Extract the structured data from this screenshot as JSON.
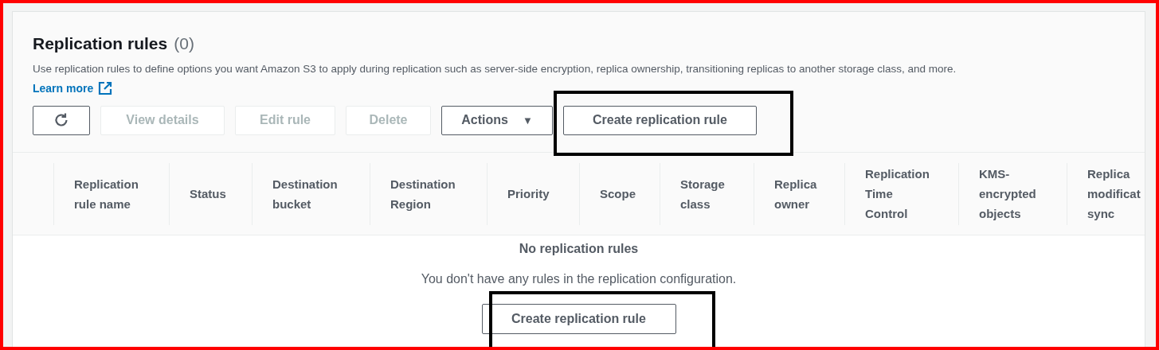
{
  "panel": {
    "title": "Replication rules",
    "count": "(0)",
    "description": "Use replication rules to define options you want Amazon S3 to apply during replication such as server-side encryption, replica ownership, transitioning replicas to another storage class, and more.",
    "learn_more": "Learn more"
  },
  "toolbar": [
    {
      "kind": "refresh",
      "disabled": false
    },
    {
      "kind": "text",
      "label": "View details",
      "disabled": true
    },
    {
      "kind": "text",
      "label": "Edit rule",
      "disabled": true
    },
    {
      "kind": "text",
      "label": "Delete",
      "disabled": true
    },
    {
      "kind": "dropdown",
      "label": "Actions",
      "caret": "▼",
      "disabled": false
    },
    {
      "kind": "text",
      "label": "Create replication rule",
      "disabled": false,
      "highlighted": true
    }
  ],
  "table": {
    "columns": [
      "Replication rule name",
      "Status",
      "Destination bucket",
      "Destination Region",
      "Priority",
      "Scope",
      "Storage class",
      "Replica owner",
      "Replication Time Control",
      "KMS-encrypted objects",
      "Replica modificat sync"
    ],
    "empty_title": "No replication rules",
    "empty_message": "You don't have any rules in the replication configuration.",
    "empty_button": {
      "label": "Create replication rule",
      "highlighted": true
    }
  }
}
